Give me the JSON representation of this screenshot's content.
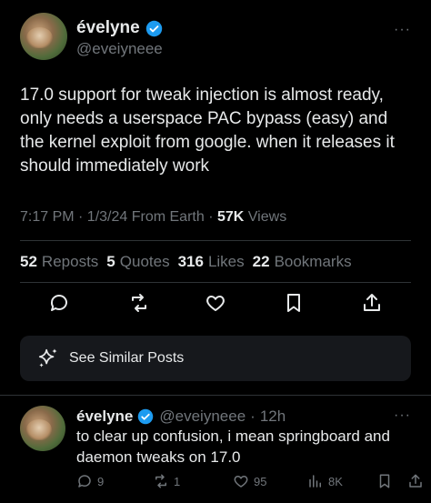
{
  "tweet": {
    "author_name": "évelyne",
    "author_handle": "@eveiyneee",
    "more_label": "···",
    "text": "17.0 support for tweak injection is almost ready, only needs a userspace PAC bypass (easy) and the kernel exploit from google. when it releases it should immediately work",
    "timestamp": "7:17 PM · 1/3/24 From Earth ·",
    "views_count": "57K",
    "views_label": "Views"
  },
  "stats": {
    "reposts_count": "52",
    "reposts_label": "Reposts",
    "quotes_count": "5",
    "quotes_label": "Quotes",
    "likes_count": "316",
    "likes_label": "Likes",
    "bookmarks_count": "22",
    "bookmarks_label": "Bookmarks"
  },
  "actions": [
    "reply-icon",
    "repost-icon",
    "like-icon",
    "bookmark-icon",
    "share-icon"
  ],
  "similar": {
    "label": "See Similar Posts"
  },
  "reply": {
    "author_name": "évelyne",
    "author_handle": "@eveiyneee",
    "separator": "·",
    "time": "12h",
    "text": "to clear up confusion, i mean springboard and daemon tweaks on 17.0",
    "replies": "9",
    "reposts": "1",
    "likes": "95",
    "views": "8K"
  },
  "colors": {
    "background": "#000000",
    "text": "#e7e9ea",
    "muted": "#71767b",
    "verified": "#1d9bf0",
    "card": "#16181c"
  }
}
